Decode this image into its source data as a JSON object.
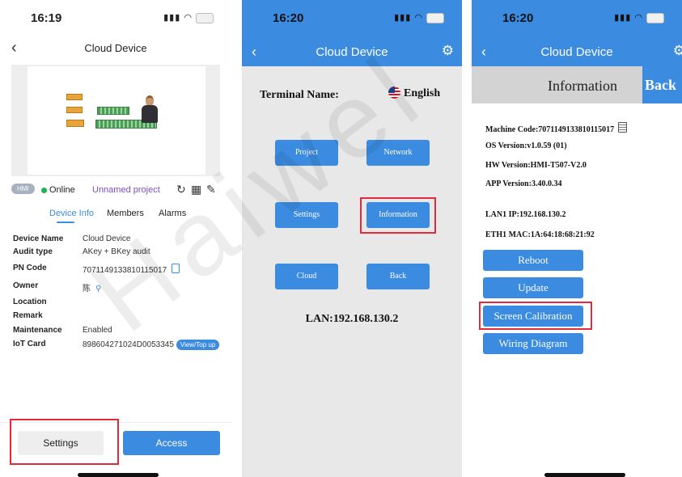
{
  "watermark": "Haiwel",
  "panel1": {
    "status": {
      "time": "16:19"
    },
    "nav": {
      "title": "Cloud Device"
    },
    "device_badge": "HMI",
    "status_label": "Online",
    "project_name": "Unnamed project",
    "tabs": [
      "Device Info",
      "Members",
      "Alarms"
    ],
    "info": [
      {
        "key": "Device Name",
        "value": "Cloud Device"
      },
      {
        "key": "Audit type",
        "value": "AKey + BKey audit"
      },
      {
        "key": "PN Code",
        "value": "7071149133810115017"
      },
      {
        "key": "Owner",
        "value": "陈"
      },
      {
        "key": "Location",
        "value": ""
      },
      {
        "key": "Remark",
        "value": ""
      },
      {
        "key": "Maintenance",
        "value": "Enabled"
      },
      {
        "key": "IoT Card",
        "value": "898604271024D0053345"
      }
    ],
    "topup_label": "View/Top up",
    "settings_button": "Settings",
    "access_button": "Access"
  },
  "panel2": {
    "status": {
      "time": "16:20"
    },
    "nav": {
      "title": "Cloud Device"
    },
    "terminal_label": "Terminal Name:",
    "language": "English",
    "buttons": [
      "Project",
      "Network",
      "Settings",
      "Information",
      "Cloud",
      "Back"
    ],
    "lan": "LAN:192.168.130.2"
  },
  "panel3": {
    "status": {
      "time": "16:20"
    },
    "nav": {
      "title": "Cloud Device"
    },
    "header_title": "Information",
    "header_back": "Back",
    "machine_code": "Machine Code:7071149133810115017",
    "os_version": "OS Version:v1.0.59 (01)",
    "hw_version": "HW Version:HMI-T507-V2.0",
    "app_version": "APP Version:3.40.0.34",
    "lan1_ip": "LAN1 IP:192.168.130.2",
    "eth1_mac": "ETH1 MAC:1A:64:18:68:21:92",
    "buttons": [
      "Reboot",
      "Update",
      "Screen Calibration",
      "Wiring Diagram"
    ]
  },
  "colors": {
    "accent": "#3b8be0",
    "highlight": "#e22a3a",
    "online": "#22b14c"
  }
}
